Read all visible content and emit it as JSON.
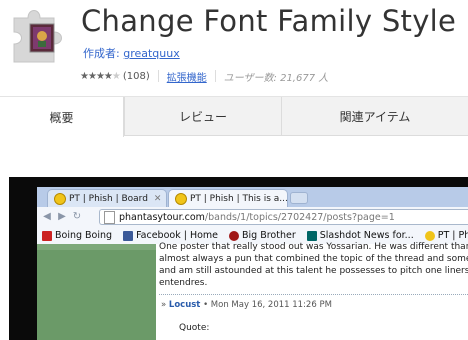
{
  "extension": {
    "title": "Change Font Family Style",
    "author_label": "作成者:",
    "author_name": "greatquux",
    "rating_count": "(108)",
    "category": "拡張機能",
    "users": "ユーザー数: 21,677 人",
    "rating": 4
  },
  "tabs": [
    {
      "label": "概要",
      "active": true
    },
    {
      "label": "レビュー",
      "active": false
    },
    {
      "label": "関連アイテム",
      "active": false
    }
  ],
  "screenshot": {
    "browser_tabs": [
      {
        "label": "PT | Phish | Board"
      },
      {
        "label": "PT | Phish | This is a..."
      }
    ],
    "url_host": "phantasytour.com",
    "url_path": "/bands/1/topics/2702427/posts?page=1",
    "bookmarks": [
      {
        "label": "Boing Boing",
        "icon": "boing-boing-icon",
        "color": "#cc2222"
      },
      {
        "label": "Facebook | Home",
        "icon": "facebook-icon",
        "color": "#3b5998"
      },
      {
        "label": "Big Brother",
        "icon": "big-brother-icon",
        "color": "#a01818"
      },
      {
        "label": "Slashdot News for...",
        "icon": "slashdot-icon",
        "color": "#006666"
      },
      {
        "label": "PT | Phish | Messa",
        "icon": "phantasytour-icon",
        "color": "#f0c419"
      }
    ],
    "post_lines": [
      "One poster that really stood out was Yossarian. He was different than rest. His one o",
      "almost always a pun that combined the topic of the thread and some deeper spiritu",
      "and am still astounded at this talent he possesses to pitch one liners with these incre",
      "entendres."
    ],
    "post_author": "Locust",
    "post_date": "• Mon May 16, 2011 11:26 PM",
    "quote_label": "Quote:"
  }
}
